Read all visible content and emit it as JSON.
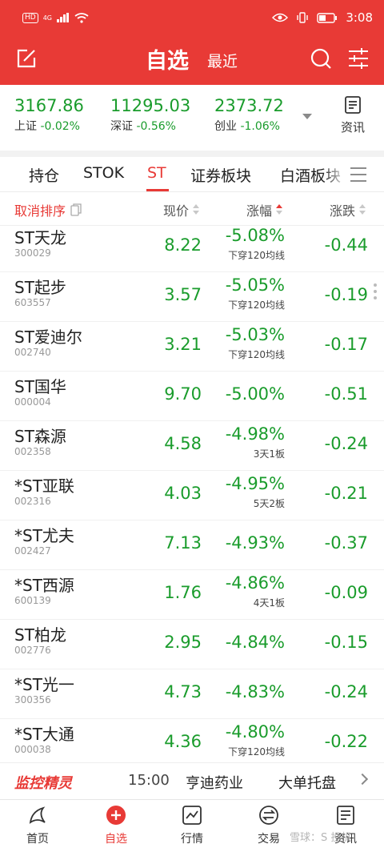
{
  "status_bar": {
    "network_badge": "HD",
    "network_type": "4G",
    "time": "3:08"
  },
  "header": {
    "title": "自选",
    "subtitle": "最近"
  },
  "indices": [
    {
      "value": "3167.86",
      "name": "上证",
      "change": "-0.02%"
    },
    {
      "value": "11295.03",
      "name": "深证",
      "change": "-0.56%"
    },
    {
      "value": "2373.72",
      "name": "创业",
      "change": "-1.06%"
    }
  ],
  "news_label": "资讯",
  "tabs": [
    {
      "label": "持仓",
      "active": false
    },
    {
      "label": "STOK",
      "active": false
    },
    {
      "label": "ST",
      "active": true
    },
    {
      "label": "证券板块",
      "active": false
    },
    {
      "label": "白酒板块",
      "active": false
    }
  ],
  "columns": {
    "cancel_sort": "取消排序",
    "price": "现价",
    "change_pct": "涨幅",
    "change": "涨跌"
  },
  "stocks": [
    {
      "name": "ST天龙",
      "code": "300029",
      "price": "8.22",
      "pct": "-5.08%",
      "tag": "下穿120均线",
      "chg": "-0.44"
    },
    {
      "name": "ST起步",
      "code": "603557",
      "price": "3.57",
      "pct": "-5.05%",
      "tag": "下穿120均线",
      "chg": "-0.19"
    },
    {
      "name": "ST爱迪尔",
      "code": "002740",
      "price": "3.21",
      "pct": "-5.03%",
      "tag": "下穿120均线",
      "chg": "-0.17"
    },
    {
      "name": "ST国华",
      "code": "000004",
      "price": "9.70",
      "pct": "-5.00%",
      "tag": "",
      "chg": "-0.51"
    },
    {
      "name": "ST森源",
      "code": "002358",
      "price": "4.58",
      "pct": "-4.98%",
      "tag": "3天1板",
      "chg": "-0.24"
    },
    {
      "name": "*ST亚联",
      "code": "002316",
      "price": "4.03",
      "pct": "-4.95%",
      "tag": "5天2板",
      "chg": "-0.21"
    },
    {
      "name": "*ST尤夫",
      "code": "002427",
      "price": "7.13",
      "pct": "-4.93%",
      "tag": "",
      "chg": "-0.37"
    },
    {
      "name": "*ST西源",
      "code": "600139",
      "price": "1.76",
      "pct": "-4.86%",
      "tag": "4天1板",
      "chg": "-0.09"
    },
    {
      "name": "ST柏龙",
      "code": "002776",
      "price": "2.95",
      "pct": "-4.84%",
      "tag": "",
      "chg": "-0.15"
    },
    {
      "name": "*ST光一",
      "code": "300356",
      "price": "4.73",
      "pct": "-4.83%",
      "tag": "",
      "chg": "-0.24"
    },
    {
      "name": "*ST大通",
      "code": "000038",
      "price": "4.36",
      "pct": "-4.80%",
      "tag": "下穿120均线",
      "chg": "-0.22"
    }
  ],
  "monitor": {
    "brand": "监控精灵",
    "time": "15:00",
    "stock": "亨迪药业",
    "event": "大单托盘"
  },
  "bottom_nav": [
    {
      "label": "首页",
      "icon": "home-icon"
    },
    {
      "label": "自选",
      "icon": "plus-circle-icon",
      "active": true
    },
    {
      "label": "行情",
      "icon": "chart-icon"
    },
    {
      "label": "交易",
      "icon": "exchange-icon"
    },
    {
      "label": "资讯",
      "icon": "document-icon"
    }
  ],
  "watermark": "雪球：S 投机",
  "colors": {
    "brand_red": "#e83a36",
    "down_green": "#1a9c2c"
  }
}
